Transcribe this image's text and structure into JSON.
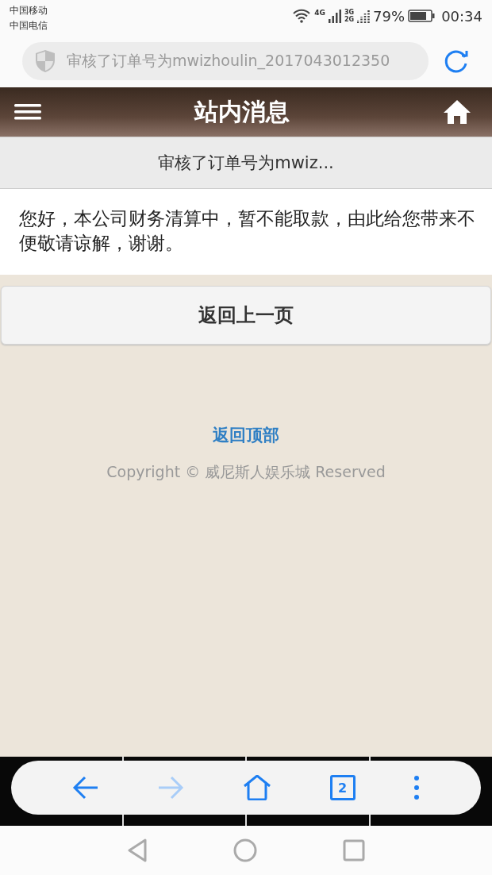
{
  "status_bar": {
    "carriers": [
      "中国移动",
      "中国电信"
    ],
    "network_1": "4G",
    "network_2": "3G",
    "network_3": "2G",
    "battery": "79%",
    "time": "00:34"
  },
  "address_bar": {
    "url": "审核了订单号为mwizhoulin_2017043012350"
  },
  "header": {
    "title": "站内消息"
  },
  "message": {
    "subject": "审核了订单号为mwiz...",
    "body": "您好，本公司财务清算中，暂不能取款，由此给您带来不便敬请谅解，谢谢。"
  },
  "back_button": "返回上一页",
  "footer": {
    "top_link": "返回顶部",
    "copyright": "Copyright © 威尼斯人娱乐城 Reserved"
  },
  "browser_toolbar": {
    "forward_disabled": true,
    "tab_count": "2"
  }
}
